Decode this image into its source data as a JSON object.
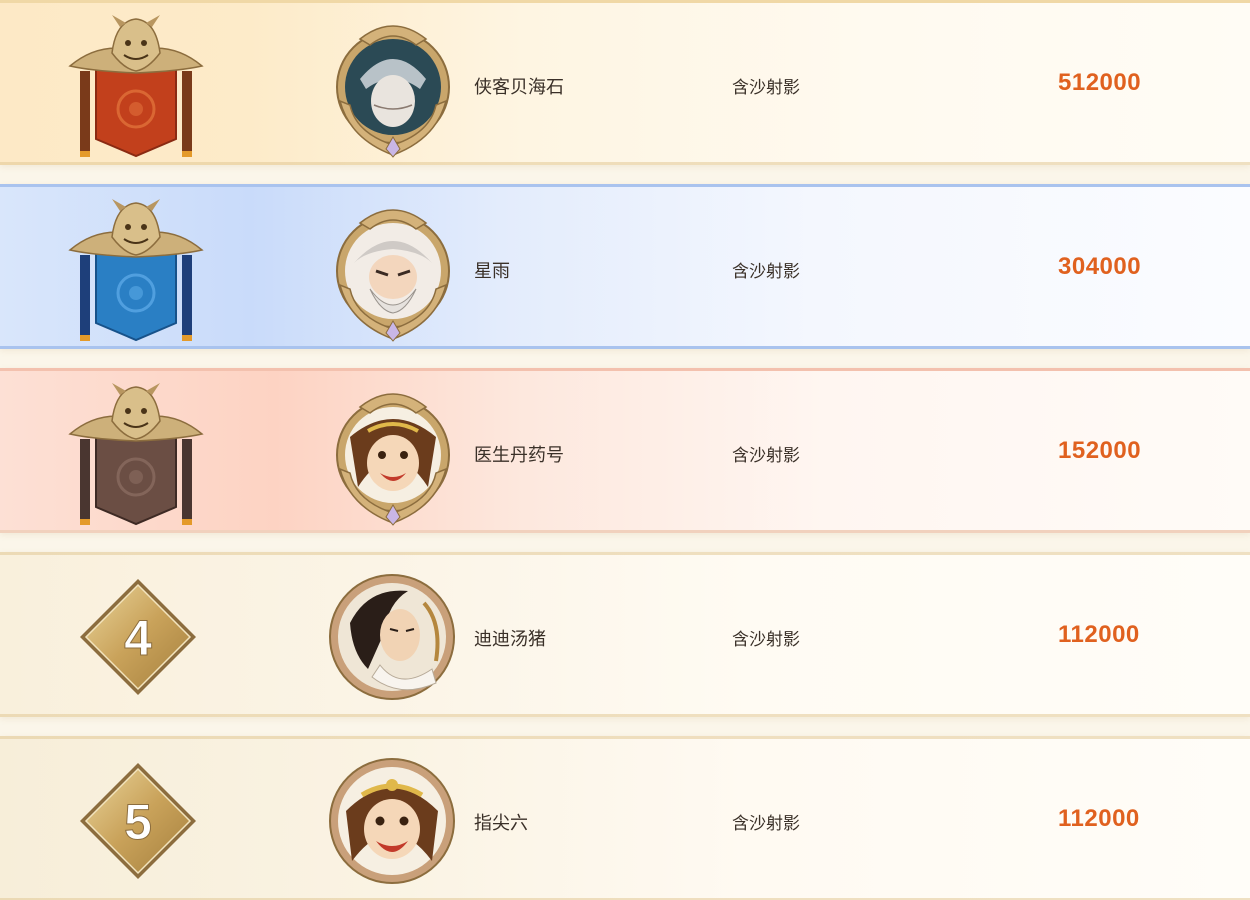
{
  "rows": [
    {
      "rank": 1,
      "name": "侠客贝海石",
      "server": "含沙射影",
      "score": "512000",
      "banner_color": "#c2401c",
      "icon": "dragon-banner-red"
    },
    {
      "rank": 2,
      "name": "星雨",
      "server": "含沙射影",
      "score": "304000",
      "banner_color": "#2a7fc4",
      "icon": "dragon-banner-blue"
    },
    {
      "rank": 3,
      "name": "医生丹药号",
      "server": "含沙射影",
      "score": "152000",
      "banner_color": "#6b4e44",
      "icon": "dragon-banner-brown"
    },
    {
      "rank": 4,
      "rank_label": "4",
      "name": "迪迪汤猪",
      "server": "含沙射影",
      "score": "112000",
      "icon": "rank-diamond"
    },
    {
      "rank": 5,
      "rank_label": "5",
      "name": "指尖六",
      "server": "含沙射影",
      "score": "112000",
      "icon": "rank-diamond"
    }
  ],
  "colors": {
    "score": "#e0611f",
    "text": "#3a3028",
    "gold": "#c9a66b"
  }
}
